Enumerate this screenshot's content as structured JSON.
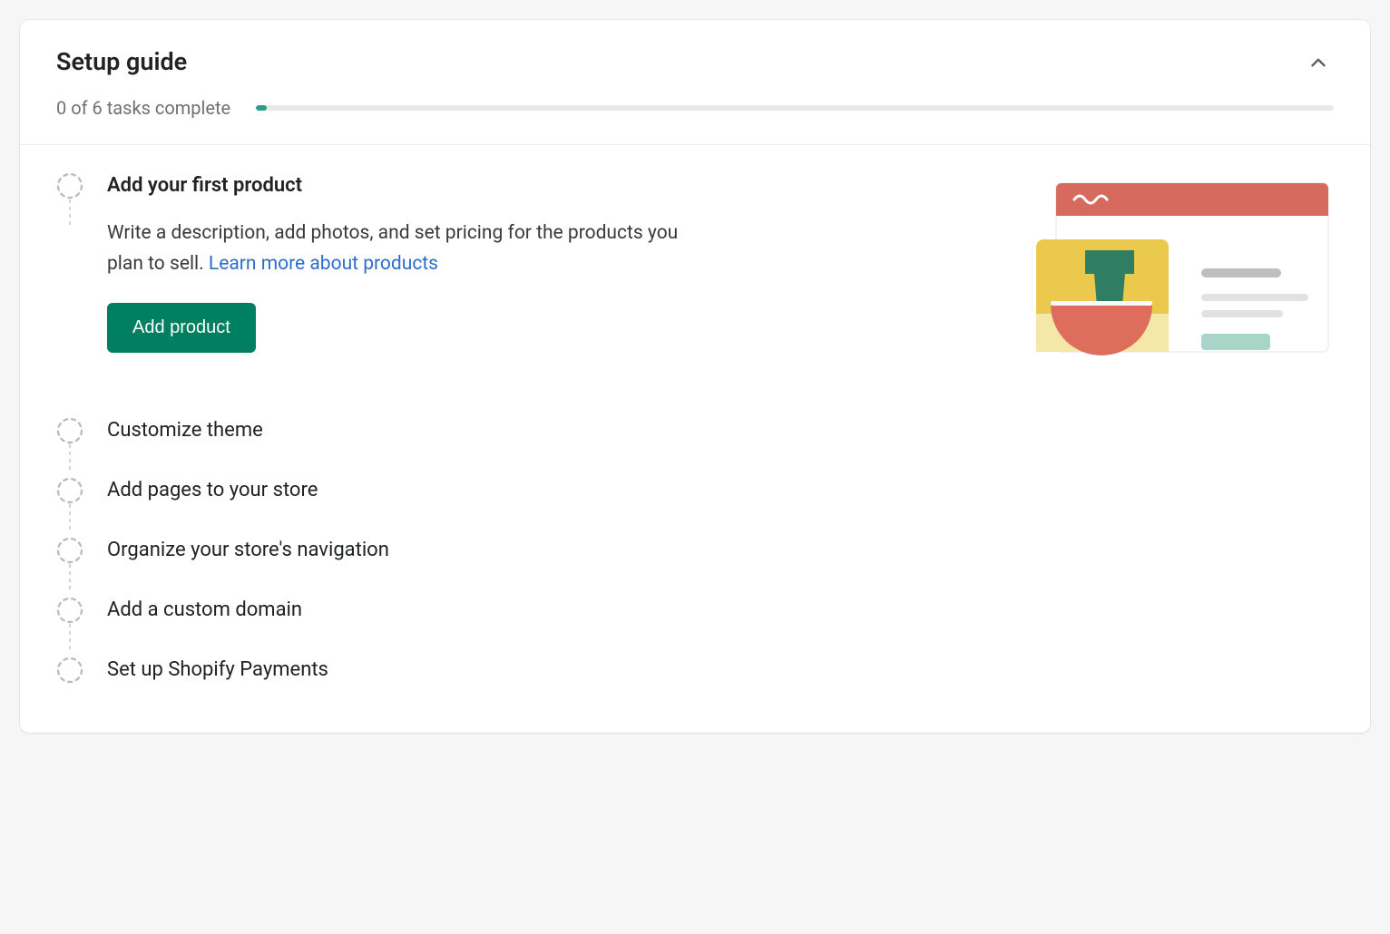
{
  "card": {
    "title": "Setup guide",
    "progress_text": "0 of 6 tasks complete",
    "progress_value": 0,
    "progress_max": 6
  },
  "tasks": [
    {
      "title": "Add your first product",
      "description": "Write a description, add photos, and set pricing for the products you plan to sell.",
      "link_text": "Learn more about products",
      "action_label": "Add product",
      "expanded": true
    },
    {
      "title": "Customize theme",
      "expanded": false
    },
    {
      "title": "Add pages to your store",
      "expanded": false
    },
    {
      "title": "Organize your store's navigation",
      "expanded": false
    },
    {
      "title": "Add a custom domain",
      "expanded": false
    },
    {
      "title": "Set up Shopify Payments",
      "expanded": false
    }
  ],
  "colors": {
    "accent": "#008060",
    "link": "#2c6ecb",
    "progress_fill": "#2a9d8f"
  }
}
